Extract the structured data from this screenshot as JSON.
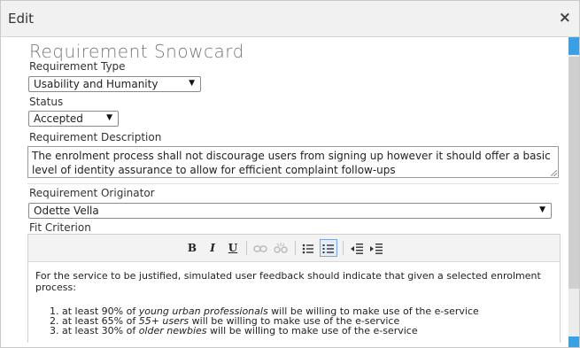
{
  "dialog": {
    "title": "Edit",
    "close_glyph": "×"
  },
  "form": {
    "heading": "Requirement Snowcard",
    "type_label": "Requirement Type",
    "type_value": "Usability and Humanity",
    "status_label": "Status",
    "status_value": "Accepted",
    "description_label": "Requirement Description",
    "description_value": "The enrolment process shall not discourage users from signing up however it should offer a basic level of identity assurance to allow for efficient complaint follow-ups",
    "originator_label": "Requirement Originator",
    "originator_value": "Odette Vella",
    "fit_label": "Fit Criterion"
  },
  "toolbar": {
    "bold": "B",
    "italic": "I",
    "underline": "U",
    "link_icon": "link-icon",
    "unlink_icon": "unlink-icon",
    "bullet_icon": "bulleted-list-icon",
    "numbered_icon": "numbered-list-icon",
    "outdent_icon": "outdent-icon",
    "indent_icon": "indent-icon"
  },
  "fit_criterion": {
    "intro": "For the service to be justified, simulated user feedback should indicate that given a selected enrolment process:",
    "items": [
      {
        "num": "1.",
        "pre": "at least 90% of ",
        "em": "young urban professionals",
        "post": " will be willing to make use of the e-service"
      },
      {
        "num": "2.",
        "pre": "at least 65% of ",
        "em": "55+ users",
        "post": " will be willing to make use of the e-service"
      },
      {
        "num": "3.",
        "pre": "at least 30% of ",
        "em": "older newbies",
        "post": " will be willing to make use of the e-service"
      }
    ]
  },
  "colors": {
    "scroll_accent": "#3aa0e4",
    "active_button": "#e4eefb"
  }
}
